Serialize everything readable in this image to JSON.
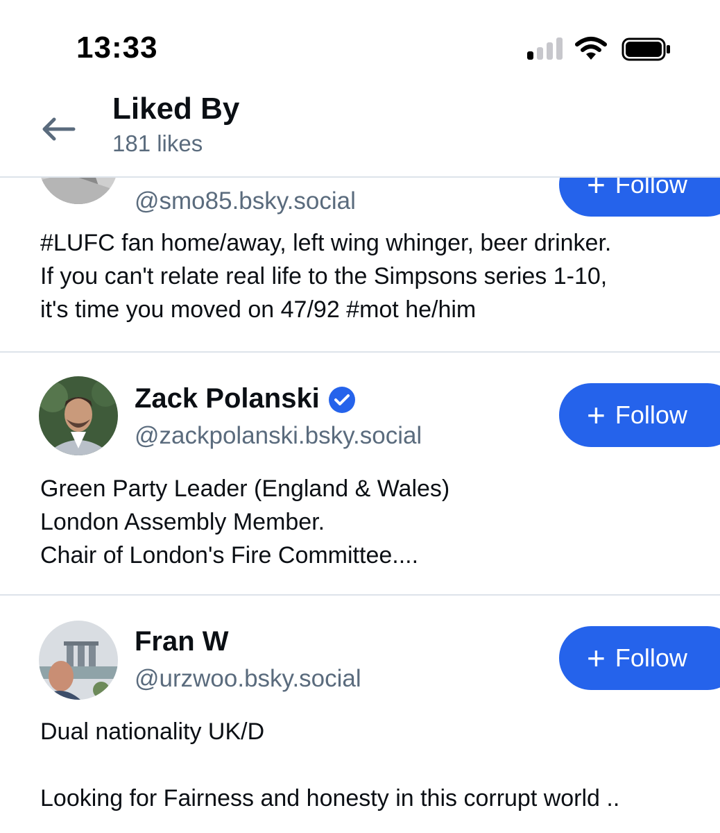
{
  "status_bar": {
    "time": "13:33",
    "signal_bars_active": 1,
    "signal_bars_total": 4
  },
  "header": {
    "title": "Liked By",
    "likes_count": "181 likes",
    "back_icon": "arrow-left-icon"
  },
  "follow_label": "Follow",
  "accent_color": "#2563eb",
  "users": [
    {
      "name": "",
      "handle": "@smo85.bsky.social",
      "verified": false,
      "bio": "#LUFC fan home/away, left wing whinger, beer drinker.\nIf you can't relate real life to the Simpsons series 1-10,\nit's time you moved on 47/92 #mot he/him"
    },
    {
      "name": "Zack Polanski",
      "handle": "@zackpolanski.bsky.social",
      "verified": true,
      "bio": "Green Party Leader (England & Wales)\nLondon Assembly Member.\nChair of London's Fire Committee...."
    },
    {
      "name": "Fran W",
      "handle": "@urzwoo.bsky.social",
      "verified": false,
      "bio": "Dual nationality UK/D\n\nLooking for Fairness and honesty in this corrupt world .."
    }
  ]
}
